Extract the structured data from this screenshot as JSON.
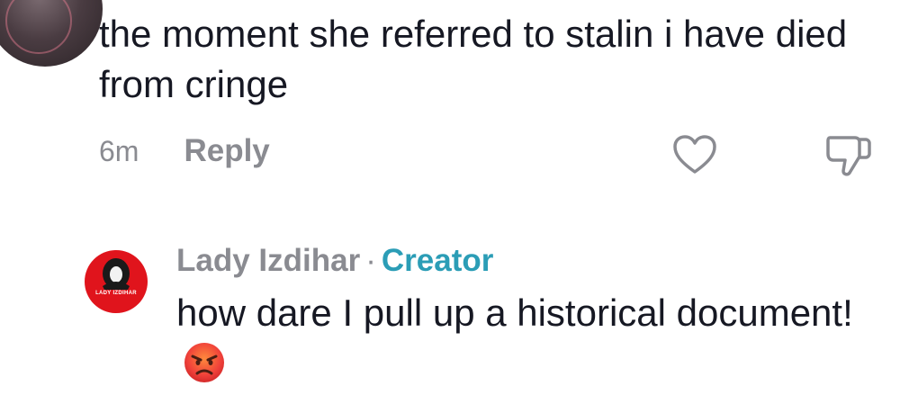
{
  "comment1": {
    "text": "the moment she referred to stalin i have died from cringe",
    "time": "6m",
    "reply_label": "Reply",
    "icons": [
      "heart-outline-icon",
      "thumbs-down-outline-icon"
    ]
  },
  "comment2": {
    "author": "Lady Izdihar",
    "separator": "·",
    "badge": "Creator",
    "text": "how dare I pull up a historical document!",
    "emoji": "angry-face-emoji",
    "avatar_caption": "LADY IZDIHAR"
  },
  "colors": {
    "text_primary": "#161823",
    "text_secondary": "#8a8b91",
    "creator_badge": "#2b9db6",
    "avatar_red": "#e0141c"
  }
}
